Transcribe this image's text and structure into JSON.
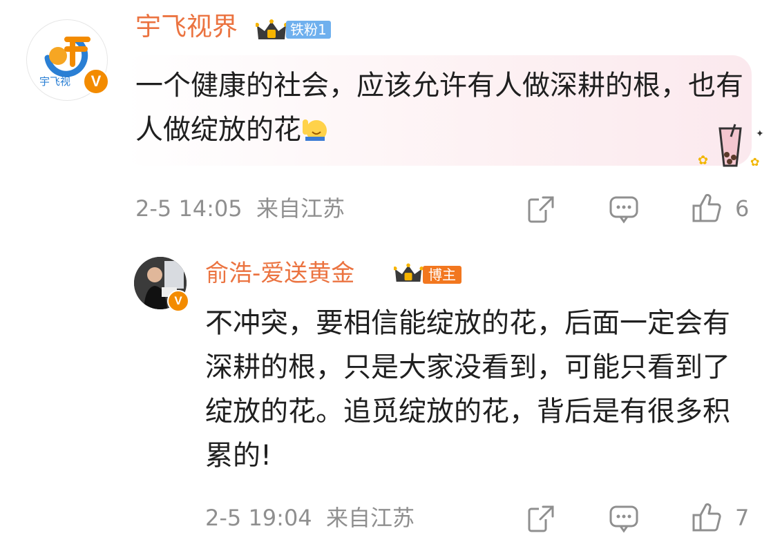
{
  "comment": {
    "username": "宇飞视界",
    "fan_badge": "铁粉1",
    "avatar_text": "宇飞视",
    "verified_mark": "V",
    "text": "一个健康的社会，应该允许有人做深耕的根，也有人做绽放的花",
    "emoji_icon": "raising-hand-smile-emoji",
    "sticker_icon": "bubble-tea-sticker",
    "date": "2-5 14:05",
    "location": "来自江苏",
    "like_count": "6"
  },
  "reply": {
    "username": "俞浩-爱送黄金",
    "role_badge": "博主",
    "verified_mark": "V",
    "text": "不冲突，要相信能绽放的花，后面一定会有深耕的根，只是大家没看到，可能只看到了绽放的花。追觅绽放的花，背后是有很多积累的!",
    "date": "2-5 19:04",
    "location": "来自江苏",
    "like_count": "7"
  },
  "colors": {
    "username": "#eb7340",
    "meta": "#8f8f8f",
    "fan_badge": "#6fb0ee",
    "role_badge": "#f2771f",
    "verified": "#f38b00"
  }
}
